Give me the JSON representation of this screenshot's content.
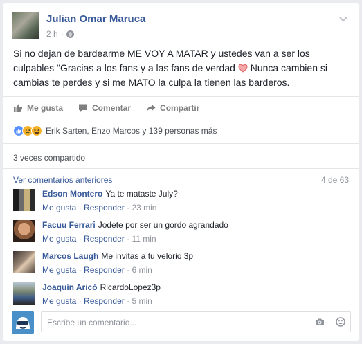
{
  "post": {
    "author": "Julian Omar Maruca",
    "time": "2 h",
    "text_part1": "Si no dejan de bardearme ME VOY A MATAR y ustedes van a ser los culpables \"Gracias a los fans y a las fans de verdad",
    "text_part2": "Nunca cambien si cambias te perdes y si me MATO la culpa la tienen las barderos."
  },
  "actions": {
    "like": "Me gusta",
    "comment": "Comentar",
    "share": "Compartir"
  },
  "reactions": {
    "text": "Erik Sarten, Enzo Marcos y 139 personas más",
    "icons": [
      "like-icon",
      "sad-icon",
      "haha-icon"
    ],
    "colors": {
      "like": "#5890ff",
      "sad": "#f7b125",
      "haha": "#f7b125"
    }
  },
  "shares": "3 veces compartido",
  "comments_nav": {
    "view_previous": "Ver comentarios anteriores",
    "count": "4 de 63"
  },
  "comments": [
    {
      "name": "Edson Montero",
      "text": "Ya te mataste July?",
      "like": "Me gusta",
      "reply": "Responder",
      "time": "23 min"
    },
    {
      "name": "Facuu Ferrari",
      "text": "Jodete por ser un gordo agrandado",
      "like": "Me gusta",
      "reply": "Responder",
      "time": "11 min"
    },
    {
      "name": "Marcos Laugh",
      "text": "Me invitas a tu velorio 3p",
      "like": "Me gusta",
      "reply": "Responder",
      "time": "6 min"
    },
    {
      "name": "Joaquín Aricó",
      "text": "RicardoLopez3p",
      "like": "Me gusta",
      "reply": "Responder",
      "time": "5 min"
    }
  ],
  "composer": {
    "placeholder": "Escribe un comentario..."
  },
  "colors": {
    "link": "#365899",
    "muted": "#90949c",
    "text": "#1d2129"
  }
}
